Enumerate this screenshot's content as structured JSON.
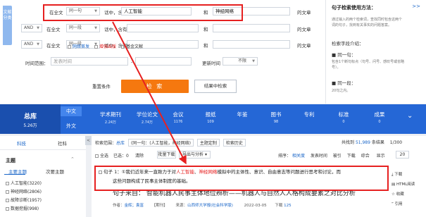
{
  "search": {
    "side_tab": "文献分类",
    "rows": [
      {
        "logic": "",
        "scope": "在全文",
        "match": "同一句",
        "mid": "话中，含有",
        "term1": "人工智能",
        "and": "和",
        "term2": "神经网络",
        "suffix": "的文章"
      },
      {
        "logic": "AND",
        "scope": "在全文",
        "match": "同一段",
        "mid": "话中，含有",
        "term1": "",
        "and": "和",
        "term2": "",
        "suffix": "的文章"
      },
      {
        "logic": "AND",
        "scope": "在全文",
        "match": "同一段",
        "mid": "话中，含有",
        "term1": "",
        "and": "和",
        "term2": "",
        "suffix": "的文章"
      }
    ],
    "options": [
      "网络首发",
      "增强出版",
      "基金文献"
    ],
    "time_label": "时间范围：",
    "time_from_placeholder": "发表时间",
    "update_label": "更新时间",
    "update_value": "不限",
    "reset_label": "重置条件",
    "search_label": "检 索",
    "result_search_label": "结果中检索"
  },
  "help": {
    "title": "句子检索使用方法：",
    "more": ">>",
    "intro": [
      "通过输入的两个检索词，查找同时包含这两个",
      "词的句子，找到有关事实的问题答案。"
    ],
    "h1": "检索字段介绍：",
    "same_sentence": "■ 同一句：",
    "same_sentence_desc": [
      "包含1个断句标点（句号、问号、感叹号或省略",
      "号）。"
    ],
    "same_para": "■ 同一段：",
    "same_para_desc": "20句之内。"
  },
  "nav": {
    "total_label": "总库",
    "total_count": "5.26万",
    "lang_zh": "中文",
    "lang_wai": "外文",
    "categories": [
      {
        "name": "学术期刊",
        "count": "2.24万"
      },
      {
        "name": "学位论文",
        "count": "2.74万"
      },
      {
        "name": "会议",
        "count": "1176"
      },
      {
        "name": "报纸",
        "count": "109"
      },
      {
        "name": "年鉴",
        "count": ""
      },
      {
        "name": "图书",
        "count": "98"
      },
      {
        "name": "专利",
        "count": ""
      },
      {
        "name": "标准",
        "count": "0"
      },
      {
        "name": "成果",
        "count": "0"
      }
    ]
  },
  "left": {
    "tab1": "科技",
    "tab2": "社科",
    "topic_label": "主题",
    "topic_tab1": "主要主题",
    "topic_tab2": "次要主题",
    "items": [
      "人工智能(3220)",
      "神经网络(2806)",
      "故障诊断(1957)",
      "数据挖掘(998)"
    ]
  },
  "results": {
    "crumb_prefix": "检索范围：",
    "crumb_scope": "总库",
    "crumb_query": "(同一句：(人工智能，神经网络)",
    "crumb_topic": "主题定制",
    "crumb_history": "检索历史",
    "found_prefix": "共找到",
    "found_count": "51,989",
    "found_suffix": "条结果",
    "page": "1/300",
    "select_all": "全选",
    "selected": "已选：0",
    "clear": "清除",
    "batch": "批量下载",
    "export": "导出与分析 ▾",
    "sort_label": "排序：",
    "sort_active": "相关度",
    "sort_items": [
      "发表时间",
      "被引",
      "下载",
      "综合"
    ],
    "show_label": "显示",
    "show_value": "20",
    "item": {
      "index": "句子 1：",
      "lead": "①我们近年来一直致力于对",
      "hl1": "人工智能",
      "mid1": "、",
      "hl2": "神经网络",
      "tail1": "模拟中的主体性、意识、自由意志等问题进行思考和讨论，而",
      "line2": "这些问题构成了民事主体制度的基础。",
      "source_label": "句子来自：",
      "source_title": "智能机器人民事主体地位辨析——机器人与自然人人格构成要素之对比分析",
      "author_label": "作者：",
      "author": "金辉；袁富",
      "type": "【期刊】",
      "venue_label": "来源：",
      "venue": "山西师大学报(社会科学版)",
      "date": "2022-03-05",
      "dl_label": "下载",
      "dl_count": "125"
    }
  },
  "actions": [
    "下载",
    "HTML阅读",
    "收藏",
    "引用"
  ]
}
